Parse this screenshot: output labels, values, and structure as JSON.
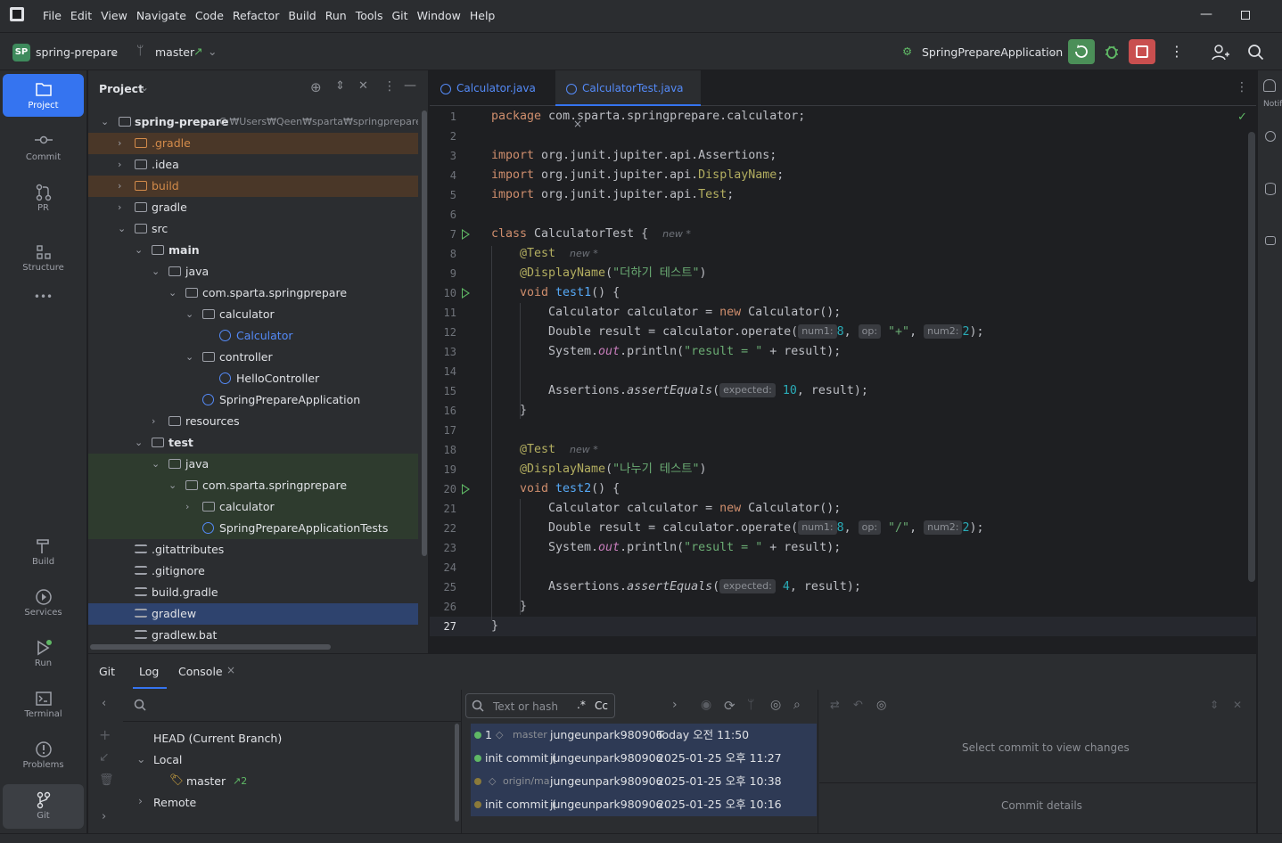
{
  "menubar": {
    "items": [
      "File",
      "Edit",
      "View",
      "Navigate",
      "Code",
      "Refactor",
      "Build",
      "Run",
      "Tools",
      "Git",
      "Window",
      "Help"
    ]
  },
  "toolbar": {
    "project_badge": "SP",
    "project_name": "spring-prepare",
    "branch": "master",
    "branch_arrow": "↗",
    "run_config": "SpringPrepareApplication"
  },
  "left_stripe": {
    "project": "Project",
    "commit": "Commit",
    "pr": "PR",
    "structure": "Structure",
    "more": "•••",
    "build": "Build",
    "services": "Services",
    "run": "Run",
    "terminal": "Terminal",
    "problems": "Problems",
    "git": "Git"
  },
  "project_panel": {
    "title": "Project",
    "root_name": "spring-prepare",
    "root_path": "C:₩Users₩Qeen₩sparta₩springprepare₩we",
    "tree": [
      {
        "label": ".gradle",
        "kind": "excl"
      },
      {
        "label": ".idea",
        "kind": "folder"
      },
      {
        "label": "build",
        "kind": "excl"
      },
      {
        "label": "gradle",
        "kind": "folder"
      },
      {
        "label": "src",
        "kind": "folder"
      },
      {
        "label": "main",
        "kind": "folder"
      },
      {
        "label": "java",
        "kind": "folder"
      },
      {
        "label": "com.sparta.springprepare",
        "kind": "pkg"
      },
      {
        "label": "calculator",
        "kind": "pkg"
      },
      {
        "label": "Calculator",
        "kind": "class"
      },
      {
        "label": "controller",
        "kind": "pkg"
      },
      {
        "label": "HelloController",
        "kind": "class"
      },
      {
        "label": "SpringPrepareApplication",
        "kind": "class"
      },
      {
        "label": "resources",
        "kind": "folder"
      },
      {
        "label": "test",
        "kind": "folder"
      },
      {
        "label": "java",
        "kind": "folder"
      },
      {
        "label": "com.sparta.springprepare",
        "kind": "pkg"
      },
      {
        "label": "calculator",
        "kind": "pkg"
      },
      {
        "label": "SpringPrepareApplicationTests",
        "kind": "class"
      },
      {
        "label": ".gitattributes",
        "kind": "file"
      },
      {
        "label": ".gitignore",
        "kind": "file"
      },
      {
        "label": "build.gradle",
        "kind": "file"
      },
      {
        "label": "gradlew",
        "kind": "file"
      },
      {
        "label": "gradlew.bat",
        "kind": "file"
      }
    ]
  },
  "editor": {
    "tabs": [
      "Calculator.java",
      "CalculatorTest.java"
    ],
    "active_tab": "CalculatorTest.java",
    "line_numbers": [
      "1",
      "2",
      "3",
      "4",
      "5",
      "6",
      "7",
      "8",
      "9",
      "10",
      "11",
      "12",
      "13",
      "14",
      "15",
      "16",
      "17",
      "18",
      "19",
      "20",
      "21",
      "22",
      "23",
      "24",
      "25",
      "26",
      "27"
    ],
    "code": {
      "l1_kw": "package",
      "l1_rest": " com.sparta.springprepare.calculator;",
      "l3_kw": "import",
      "l3_rest": " org.junit.jupiter.api.Assertions;",
      "l4_kw": "import",
      "l4_rest": " org.junit.jupiter.api.",
      "l4_ann": "DisplayName",
      "l4_end": ";",
      "l5_kw": "import",
      "l5_rest": " org.junit.jupiter.api.",
      "l5_ann": "Test",
      "l5_end": ";",
      "l7_kw": "class",
      "l7_rest": " CalculatorTest ",
      "l7_brace": "{",
      "new_hint": "new *",
      "l8_ann": "@Test",
      "l9_ann": "@DisplayName",
      "l9_open": "(",
      "l9_str": "\"더하기 테스트\"",
      "l9_close": ")",
      "l10_kw": "void",
      "l10_fn": "test1",
      "l10_rest": "() {",
      "l11_a": "Calculator calculator = ",
      "l11_kw": "new",
      "l11_b": " Calculator();",
      "l12_a": "Double result = calculator.operate(",
      "hint_num1": "num1:",
      "l12_num1": "8",
      ", ": ", ",
      "hint_op": "op:",
      "l12_op": "\"+\"",
      "hint_num2": "num2:",
      "l12_num2": "2",
      "l12_end": ");",
      "l13_a": "System.",
      "l13_out": "out",
      "l13_b": ".println(",
      "l13_str": "\"result = \"",
      "l13_c": " + result);",
      "l15_a": "Assertions.",
      "l15_fn": "assertEquals",
      "l15_open": "(",
      "hint_expected": "expected:",
      "l15_num": "10",
      "l15_end": ", result);",
      "close_brace": "}",
      "l19_str": "\"나누기 테스트\"",
      "l20_fn": "test2",
      "l22_op": "\"/\"",
      "l25_num": "4"
    }
  },
  "bottom_panel": {
    "tabs": {
      "git": "Git",
      "log": "Log",
      "console": "Console"
    },
    "branches": {
      "head": "HEAD (Current Branch)",
      "local": "Local",
      "master": "master",
      "master_ahead": "↗2",
      "remote": "Remote"
    },
    "search_placeholder": "Text or hash",
    "regex": ".*",
    "case": "Cc",
    "commits": [
      {
        "msg": "1",
        "ref": "master",
        "author": "jungeunpark980906",
        "date": "Today 오전 11:50"
      },
      {
        "msg": "init commit (",
        "ref": "",
        "author": "jungeunpark980906",
        "date": "2025-01-25 오후 11:27"
      },
      {
        "msg": "",
        "ref": "origin/ma",
        "author": "jungeunpark980906",
        "date": "2025-01-25 오후 10:38"
      },
      {
        "msg": "init commit (",
        "ref": "",
        "author": "jungeunpark980906",
        "date": "2025-01-25 오후 10:16"
      }
    ],
    "details_empty": "Select commit to view changes",
    "commit_details": "Commit details"
  },
  "right_stripe": {
    "notifications": "Notif"
  },
  "colors": {
    "accent": "#3574f0",
    "run_green": "#4b8f58",
    "stop_red": "#c94f4f"
  }
}
